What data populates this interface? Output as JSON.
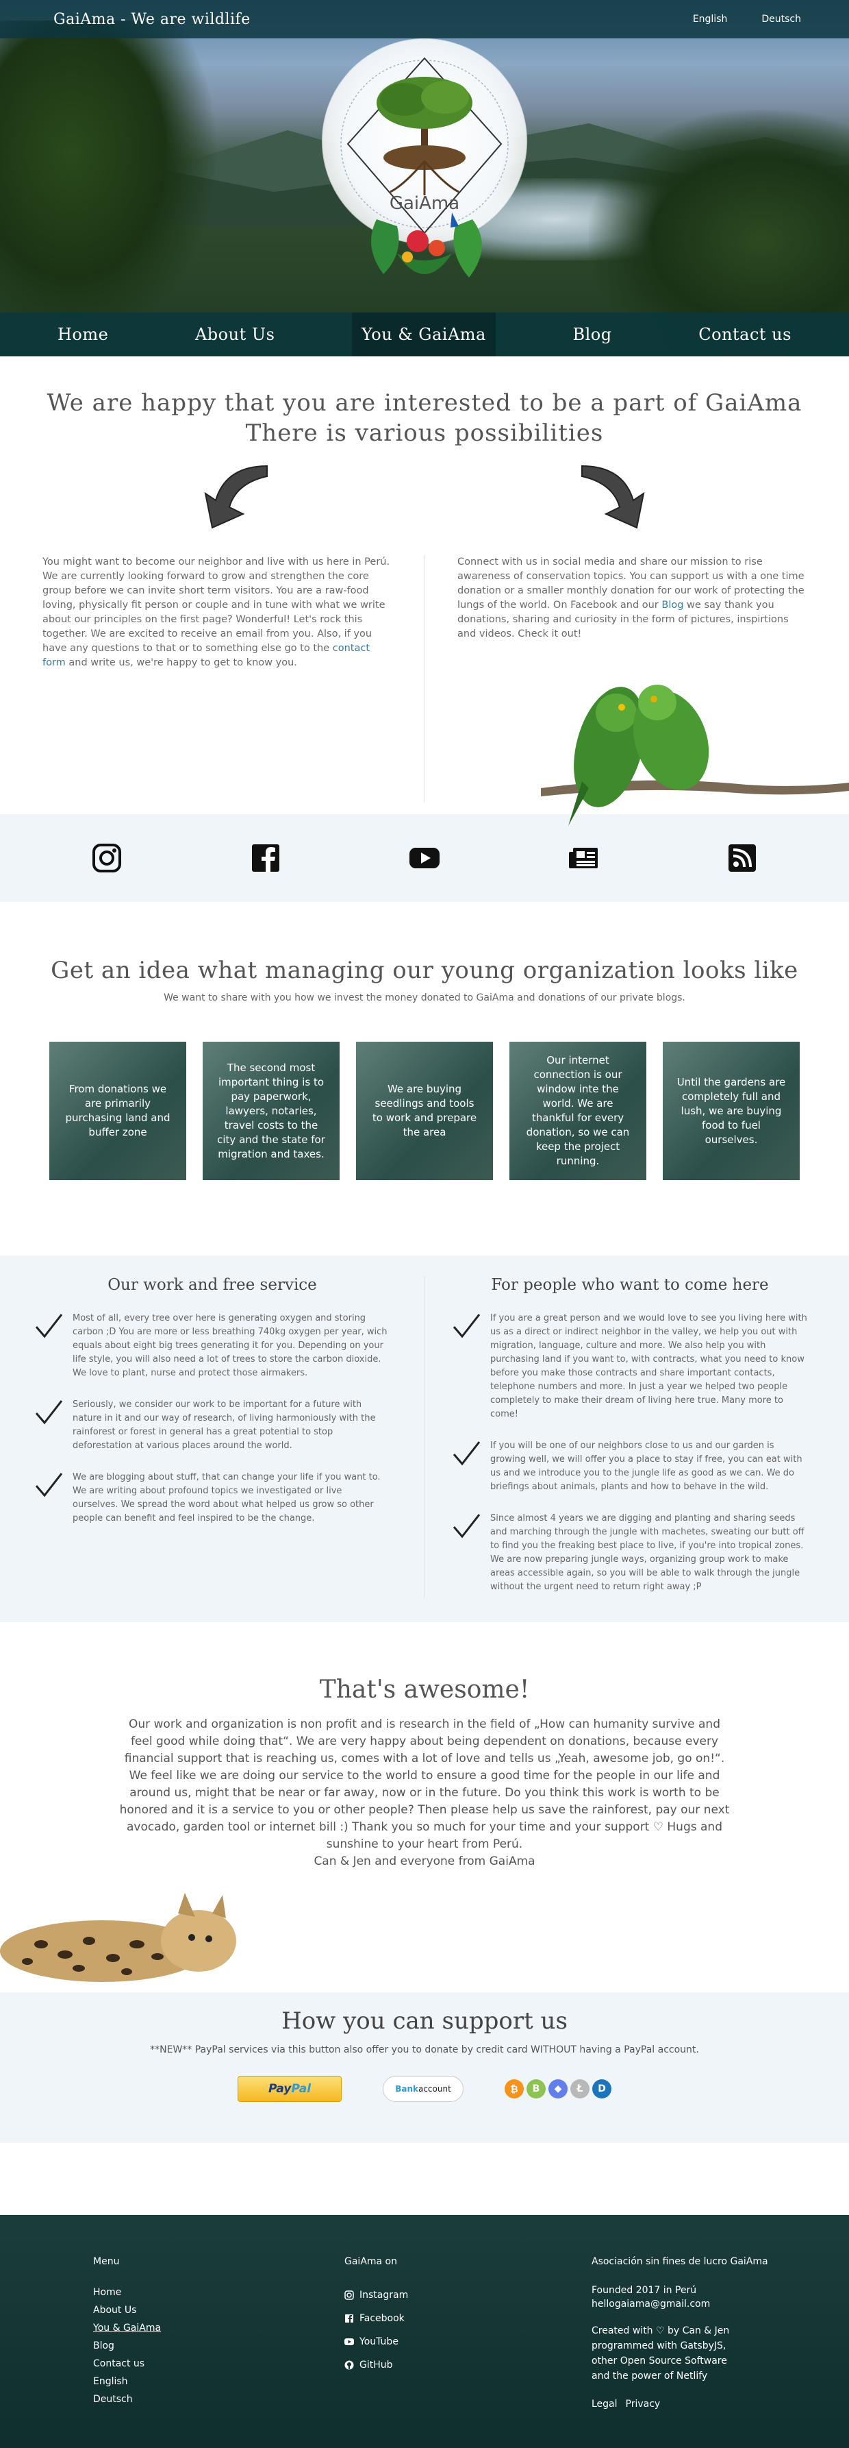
{
  "topbar": {
    "brand": "GaiAma - We are wildlife",
    "languages": [
      "English",
      "Deutsch"
    ]
  },
  "hero": {
    "logo_text": "GaiAma"
  },
  "nav": {
    "items": [
      "Home",
      "About Us",
      "You & GaiAma",
      "Blog",
      "Contact us"
    ],
    "active_index": 2
  },
  "intro": {
    "heading_line1": "We are happy that you are interested to be a part of GaiAma",
    "heading_line2": "There is various possibilities",
    "left_text_before_link": "You might want to become our neighbor and live with us here in Perú. We are currently looking forward to grow and strengthen the core group before we can invite short term visitors. You are a raw-food loving, physically fit person or couple and in tune with what we write about our principles on the first page? Wonderful! Let's rock this together. We are excited to receive an email from you. Also, if you have any questions to that or to something else go to the ",
    "left_link": "contact form",
    "left_text_after_link": " and write us, we're happy to get to know you.",
    "right_text_before_link": "Connect with us in social media and share our mission to rise awareness of conservation topics. You can support us with a one time donation or a smaller monthly donation for our work of protecting the lungs of the world. On Facebook and our ",
    "right_link": "Blog",
    "right_text_after_link": " we say thank you donations, sharing and curiosity in the form of pictures, inspirtions and videos. Check it out!"
  },
  "social_icons": [
    "instagram-icon",
    "facebook-icon",
    "youtube-icon",
    "blog-icon",
    "rss-icon"
  ],
  "idea": {
    "heading": "Get an idea what managing our young organization looks like",
    "subheading": "We want to share with you how we invest the money donated to GaiAma and donations of our private blogs.",
    "cards": [
      "From donations we are primarily purchasing land and buffer zone",
      "The second most important thing is to pay paperwork, lawyers, notaries, travel costs to the city and the state for migration and taxes.",
      "We are buying seedlings and tools to work and prepare the area",
      "Our internet connection is our window inte the world. We are thankful for every donation, so we can keep the project running.",
      "Until the gardens are completely full and lush, we are buying food to fuel ourselves."
    ]
  },
  "work": {
    "left_heading": "Our work and free service",
    "left_items": [
      "Most of all, every tree over here is generating oxygen and storing carbon ;D You are more or less breathing 740kg oxygen per year, wich equals about eight big trees generating it for you. Depending on your life style, you will also need a lot of trees to store the carbon dioxide. We love to plant, nurse and protect those airmakers.",
      "Seriously, we consider our work to be important for a future with nature in it and our way of research, of living harmoniously with the rainforest or forest in general has a great potential to stop deforestation at various places around the world.",
      "We are blogging about stuff, that can change your life if you want to. We are writing about profound topics we investigated or live ourselves. We spread the word about what helped us grow so other people can benefit and feel inspired to be the change."
    ],
    "right_heading": "For people who want to come here",
    "right_items": [
      "If you are a great person and we would love to see you living here with us as a direct or indirect neighbor in the valley, we help you out with migration, language, culture and more. We also help you with purchasing land if you want to, with contracts, what you need to know before you make those contracts and share important contacts, telephone numbers and more. In just a year we helped two people completely to make their dream of living here true. Many more to come!",
      "If you will be one of our neighbors close to us and our garden is growing well, we will offer you a place to stay if free, you can eat with us and we introduce you to the jungle life as good as we can. We do briefings about animals, plants and how to behave in the wild.",
      "Since almost 4 years we are digging and planting and sharing seeds and marching through the jungle with machetes, sweating our butt off to find you the freaking best place to live, if you're into tropical zones. We are now preparing jungle ways, organizing group work to make areas accessible again, so you will be able to walk through the jungle without the urgent need to return right away ;P"
    ]
  },
  "awesome": {
    "heading": "That's awesome!",
    "text": "Our work and organization is non profit and is research in the field of „How can humanity survive and feel good while doing that“. We are very happy about being dependent on donations, because every financial support that is reaching us, comes with a lot of love and tells us „Yeah, awesome job, go on!“. We feel like we are doing our service to the world to ensure a good time for the people in our life and around us, might that be near or far away, now or in the future. Do you think this work is worth to be honored and it is a service to you or other people? Then please help us save the rainforest, pay our next avocado, garden tool or internet bill :) Thank you so much for your time and your support ♡ Hugs and sunshine to your heart from Perú.",
    "signature": "Can & Jen and everyone from GaiAma"
  },
  "support": {
    "heading": "How you can support us",
    "note": "**NEW** PayPal services via this button also offer you to donate by credit card WITHOUT having a PayPal account.",
    "paypal_pay": "Pay",
    "paypal_pal": "Pal",
    "bank_prefix": "Bank",
    "bank_suffix": "account",
    "coins": [
      {
        "symbol": "₿",
        "color": "#f7931a"
      },
      {
        "symbol": "B",
        "color": "#8dc351"
      },
      {
        "symbol": "◆",
        "color": "#627eea"
      },
      {
        "symbol": "Ł",
        "color": "#b8b8b8"
      },
      {
        "symbol": "D",
        "color": "#1c75bc"
      }
    ]
  },
  "footer": {
    "menu_heading": "Menu",
    "menu_items": [
      "Home",
      "About Us",
      "You & GaiAma",
      "Blog",
      "Contact us",
      "English",
      "Deutsch"
    ],
    "menu_active_index": 2,
    "on_heading": "GaiAma on",
    "social_links": [
      {
        "label": "Instagram",
        "icon": "instagram-icon"
      },
      {
        "label": "Facebook",
        "icon": "facebook-icon"
      },
      {
        "label": "YouTube",
        "icon": "youtube-icon"
      },
      {
        "label": "GitHub",
        "icon": "github-icon"
      }
    ],
    "org_heading": "Asociación sin fines de lucro GaiAma",
    "founded": "Founded 2017 in Perú",
    "email": "hellogaiama@gmail.com",
    "credits_line1": "Created with ♡ by Can & Jen",
    "credits_line2": "programmed with GatsbyJS,",
    "credits_line3": "other Open Source Software",
    "credits_line4": "and the power of Netlify",
    "legal": "Legal",
    "privacy": "Privacy"
  }
}
